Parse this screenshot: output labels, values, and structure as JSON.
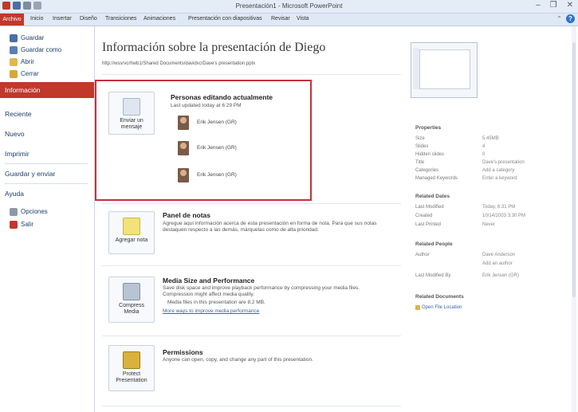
{
  "window": {
    "title": "Presentación1 - Microsoft PowerPoint",
    "controls": [
      "–",
      "❐",
      "✕"
    ]
  },
  "ribbon": {
    "file_tab": "Archivo",
    "tabs": [
      "Inicio",
      "Insertar",
      "Diseño",
      "Transiciones",
      "Animaciones",
      "Presentación con diapositivas",
      "Revisar",
      "Vista"
    ],
    "help": "?"
  },
  "nav": {
    "save": "Guardar",
    "save_as": "Guardar como",
    "open": "Abrir",
    "close": "Cerrar",
    "info": "Información",
    "recent": "Reciente",
    "new": "Nuevo",
    "print": "Imprimir",
    "save_send": "Guardar y enviar",
    "help": "Ayuda",
    "options": "Opciones",
    "exit": "Salir"
  },
  "main": {
    "title": "Información sobre la presentación de Diego",
    "path": "http://wssrvcrhwb1/Shared Documents/davidxc/Dave's presentation.pptx",
    "editing": {
      "button": "Enviar un mensaje",
      "heading": "Personas editando actualmente",
      "updated": "Last updated today at 6:29 PM",
      "people": [
        "Erik Jensen (GR)",
        "Erik Jensen (GR)",
        "Erik Jensen (GR)"
      ]
    },
    "notes": {
      "button": "Agregar nota",
      "heading": "Panel de notas",
      "text": "Agregue aquí información acerca de esta presentación en forma de nota. Para que sus notas destaquen respecto a las demás, márquelas como de alta prioridad."
    },
    "media": {
      "button": "Compress Media",
      "heading": "Media Size and Performance",
      "text": "Save disk space and improve playback performance by compressing your media files. Compression might affect media quality.",
      "bullet": "Media files in this presentation are 8.2 MB.",
      "link": "More ways to improve media performance"
    },
    "permissions": {
      "button": "Protect Presentation",
      "heading": "Permissions",
      "text": "Anyone can open, copy, and change any part of this presentation."
    }
  },
  "properties": {
    "heading": "Properties",
    "rows": [
      {
        "k": "Size",
        "v": "5.45MB"
      },
      {
        "k": "Slides",
        "v": "4"
      },
      {
        "k": "Hidden slides",
        "v": "0"
      },
      {
        "k": "Title",
        "v": "Dave's presentation"
      },
      {
        "k": "Categories",
        "v": "Add a category"
      },
      {
        "k": "Managed Keywords",
        "v": "Enter a keyword"
      }
    ],
    "dates_heading": "Related Dates",
    "dates": [
      {
        "k": "Last Modified",
        "v": "Today, 6:31 PM"
      },
      {
        "k": "Created",
        "v": "10/14/2003 3:30 PM"
      },
      {
        "k": "Last Printed",
        "v": "Never"
      }
    ],
    "people_heading": "Related People",
    "people": [
      {
        "k": "Author",
        "v": "Dave Anderson"
      },
      {
        "k": "",
        "v": "Add an author"
      },
      {
        "k": "Last Modified By",
        "v": "Erik Jensen (GR)"
      }
    ],
    "docs_heading": "Related Documents",
    "open_location": "Open File Location"
  },
  "colors": {
    "file_tab": "#c0392b",
    "highlight": "#c4323a",
    "accent": "#2d74c8"
  }
}
